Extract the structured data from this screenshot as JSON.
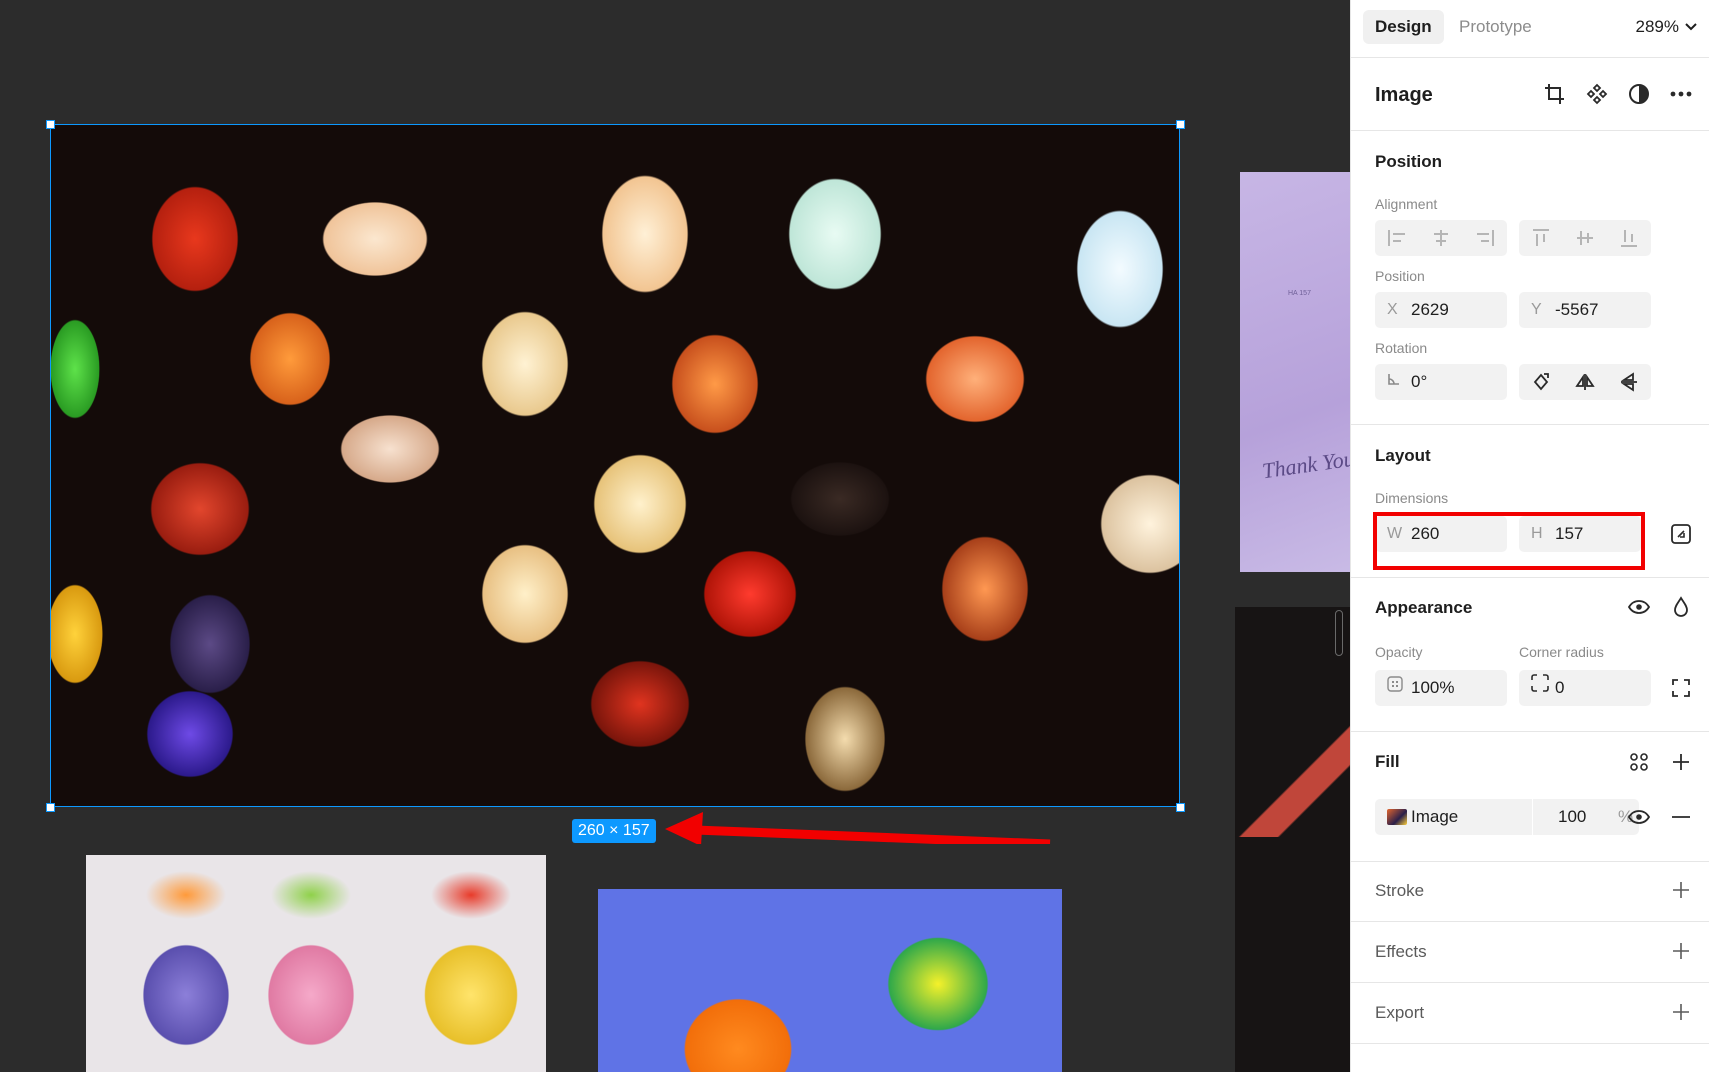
{
  "panel": {
    "tabs": [
      {
        "label": "Design",
        "active": true
      },
      {
        "label": "Prototype",
        "active": false
      }
    ],
    "zoom": "289%",
    "layer_title": "Image",
    "position_section": {
      "title": "Position",
      "alignment_label": "Alignment",
      "position_label": "Position",
      "x_prefix": "X",
      "x_value": "2629",
      "y_prefix": "Y",
      "y_value": "-5567",
      "rotation_label": "Rotation",
      "rotation_value": "0°"
    },
    "layout_section": {
      "title": "Layout",
      "dimensions_label": "Dimensions",
      "w_prefix": "W",
      "w_value": "260",
      "h_prefix": "H",
      "h_value": "157"
    },
    "appearance_section": {
      "title": "Appearance",
      "opacity_label": "Opacity",
      "opacity_value": "100%",
      "corner_radius_label": "Corner radius",
      "corner_radius_value": "0"
    },
    "fill_section": {
      "title": "Fill",
      "fill_type": "Image",
      "fill_opacity": "100",
      "fill_opacity_unit": "%"
    },
    "stroke_title": "Stroke",
    "effects_title": "Effects",
    "export_title": "Export"
  },
  "canvas": {
    "selection_size_badge": "260 × 157",
    "card_code": "HA 157",
    "card_text": "Thank You"
  },
  "colors": {
    "selection": "#0d99ff",
    "annotation": "#f20000",
    "panel_bg": "#ffffff",
    "canvas_bg": "#2c2c2c"
  }
}
